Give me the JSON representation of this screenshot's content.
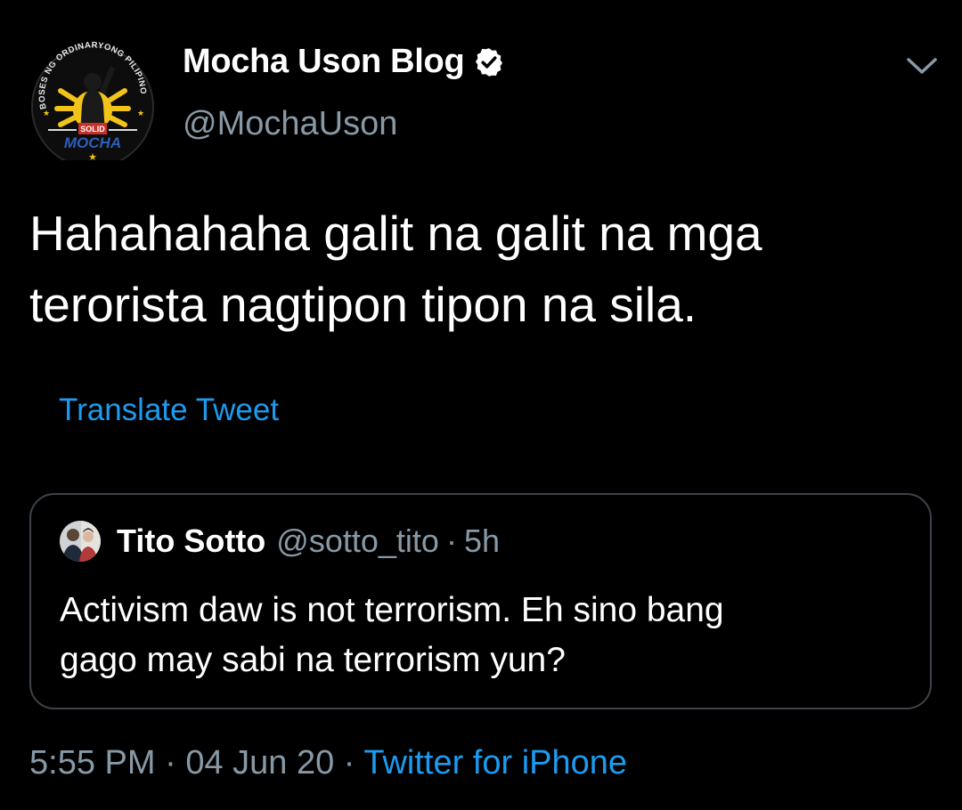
{
  "author": {
    "display_name": "Mocha Uson Blog",
    "handle": "@MochaUson",
    "avatar_arc_text": "BOSES NG ORDINARYONG PILIPINO",
    "avatar_badge_top": "SOLID",
    "avatar_badge_bottom": "MOCHA",
    "verified_icon": "verified-badge-icon",
    "menu_icon": "chevron-down-icon"
  },
  "tweet": {
    "text_line1": "Hahahahaha galit na galit na mga",
    "text_line2": "terorista nagtipon tipon na sila.",
    "translate_label": "Translate Tweet"
  },
  "quoted": {
    "display_name": "Tito Sotto",
    "handle": "@sotto_tito",
    "separator": "·",
    "time": "5h",
    "text_line1": "Activism daw is not terrorism. Eh sino bang",
    "text_line2": "gago may sabi na terrorism yun?"
  },
  "footer": {
    "time": "5:55 PM",
    "separator1": "·",
    "date": "04 Jun 20",
    "separator2": "·",
    "source": "Twitter for iPhone"
  },
  "colors": {
    "background": "#000000",
    "accent": "#1d9bf0",
    "secondary_text": "#8899a6",
    "border": "#3d4349"
  }
}
